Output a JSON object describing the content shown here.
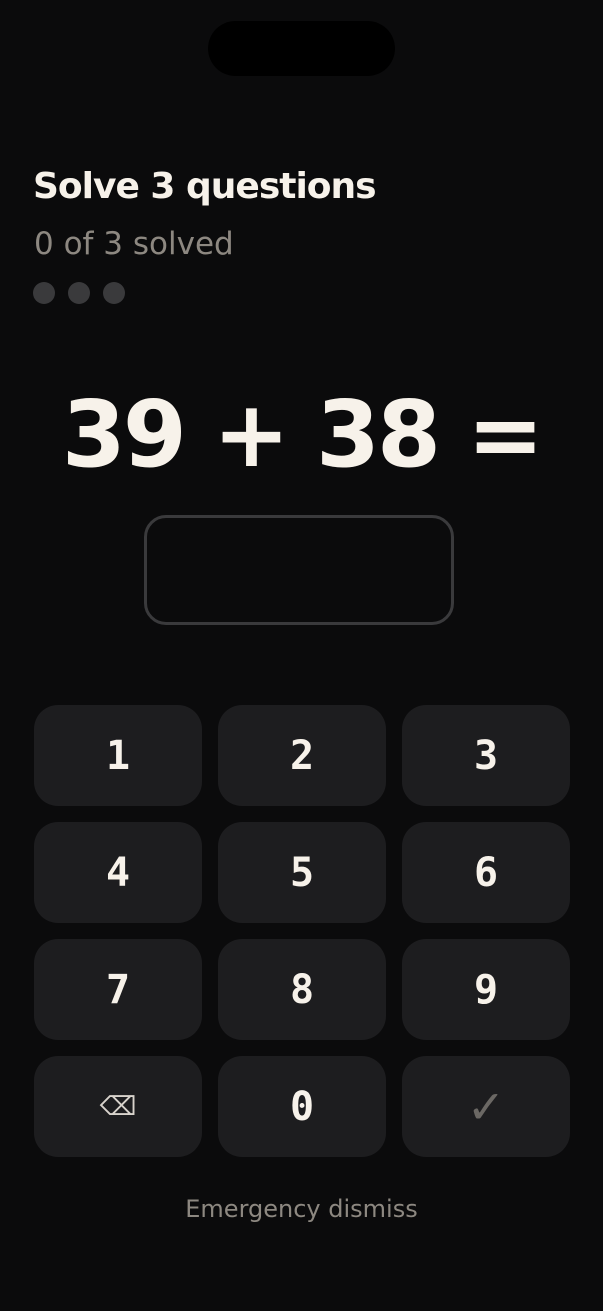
{
  "header": {
    "title": "Solve 3 questions",
    "progress": "0 of 3 solved",
    "total_questions": 3,
    "solved_count": 0
  },
  "question": {
    "equation": "39 + 38 ="
  },
  "answer": {
    "value": "",
    "placeholder": ""
  },
  "keypad": {
    "keys": [
      {
        "label": "1",
        "name": "key-1"
      },
      {
        "label": "2",
        "name": "key-2"
      },
      {
        "label": "3",
        "name": "key-3"
      },
      {
        "label": "4",
        "name": "key-4"
      },
      {
        "label": "5",
        "name": "key-5"
      },
      {
        "label": "6",
        "name": "key-6"
      },
      {
        "label": "7",
        "name": "key-7"
      },
      {
        "label": "8",
        "name": "key-8"
      },
      {
        "label": "9",
        "name": "key-9"
      },
      {
        "label": "⌫",
        "name": "backspace-key",
        "icon": "backspace-icon"
      },
      {
        "label": "0",
        "name": "key-0"
      },
      {
        "label": "✓",
        "name": "submit-key",
        "icon": "checkmark-icon"
      }
    ]
  },
  "footer": {
    "emergency_label": "Emergency dismiss"
  },
  "colors": {
    "background": "#0b0b0c",
    "text_primary": "#f7f2ea",
    "text_muted": "#8d8881",
    "key_background": "#1d1d1f",
    "dot_inactive": "#3a3a3c"
  }
}
